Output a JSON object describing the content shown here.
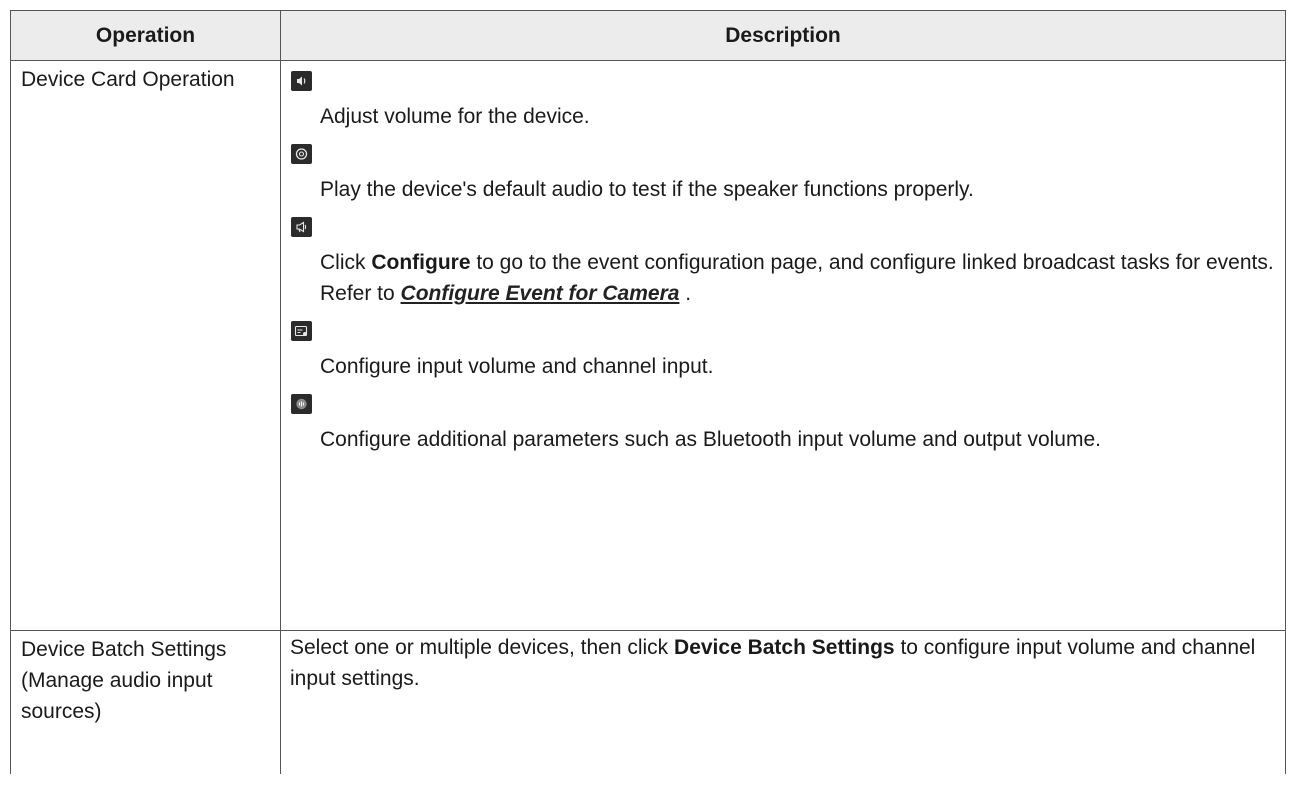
{
  "table": {
    "header": {
      "operation": "Operation",
      "description": "Description"
    },
    "rows": [
      {
        "operation": "Device Card Operation",
        "items": [
          {
            "icon": "volume-icon",
            "text": "Adjust volume for the device."
          },
          {
            "icon": "audio-test-icon",
            "text": "Play the device's default audio to test if the speaker functions properly."
          },
          {
            "icon": "broadcast-icon",
            "text_before": "Click ",
            "bold": "Configure",
            "text_middle": " to go to the event configuration page, and configure linked broadcast tasks for events. Refer to ",
            "link": "Configure Event for Camera",
            "text_after": " ."
          },
          {
            "icon": "input-settings-icon",
            "text": "Configure input volume and channel input."
          },
          {
            "icon": "bluetooth-audio-icon",
            "text": "Configure additional parameters such as Bluetooth input volume and output volume."
          }
        ]
      },
      {
        "operation": "Device Batch Settings (Manage audio input sources)",
        "text_before": "Select one or multiple devices, then click ",
        "bold": "Device Batch Settings",
        "text_after": " to configure input volume and channel input settings."
      }
    ]
  }
}
